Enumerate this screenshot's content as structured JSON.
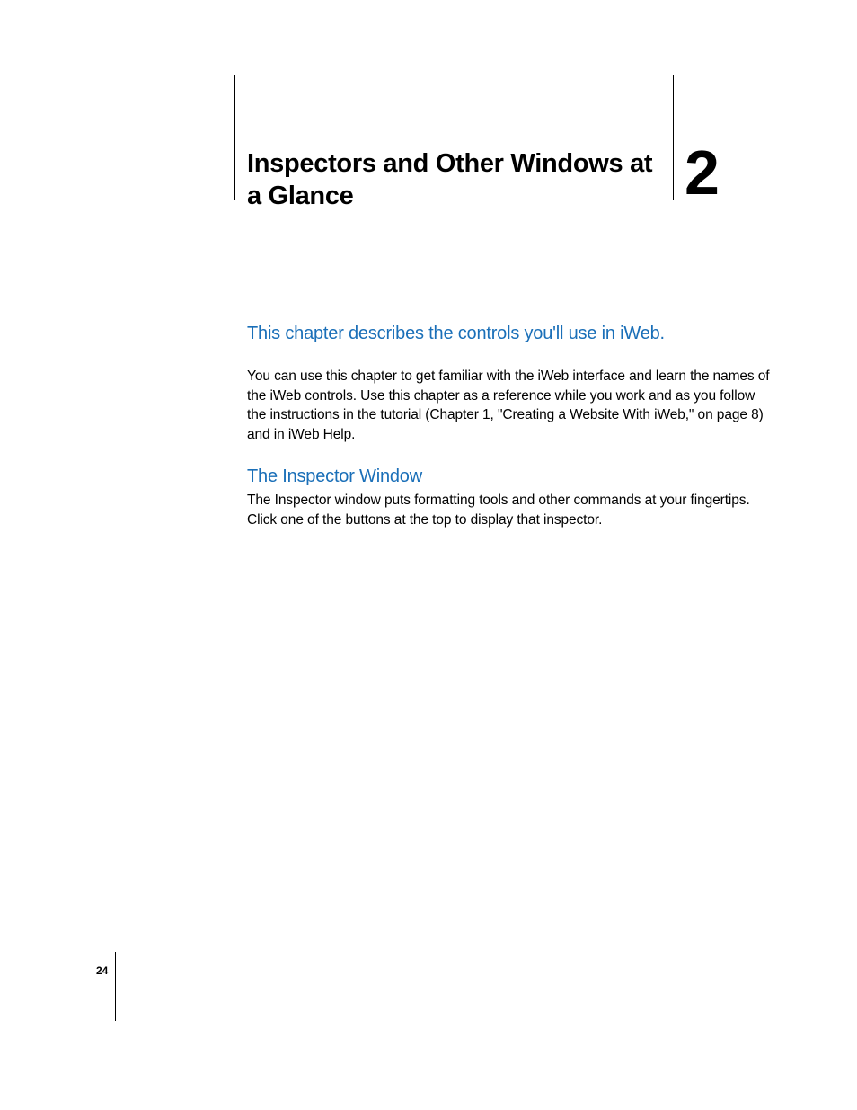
{
  "chapter": {
    "title": "Inspectors and Other Windows at a Glance",
    "number": "2"
  },
  "intro": "This chapter describes the controls you'll use in iWeb.",
  "paragraphs": {
    "p1": "You can use this chapter to get familiar with the iWeb interface and learn the names of the iWeb controls. Use this chapter as a reference while you work and as you follow the instructions in the tutorial (Chapter 1, \"Creating a Website With iWeb,\" on page 8) and in iWeb Help."
  },
  "section": {
    "heading": "The Inspector Window",
    "body": "The Inspector window puts formatting tools and other commands at your fingertips. Click one of the buttons at the top to display that inspector."
  },
  "pageNumber": "24"
}
